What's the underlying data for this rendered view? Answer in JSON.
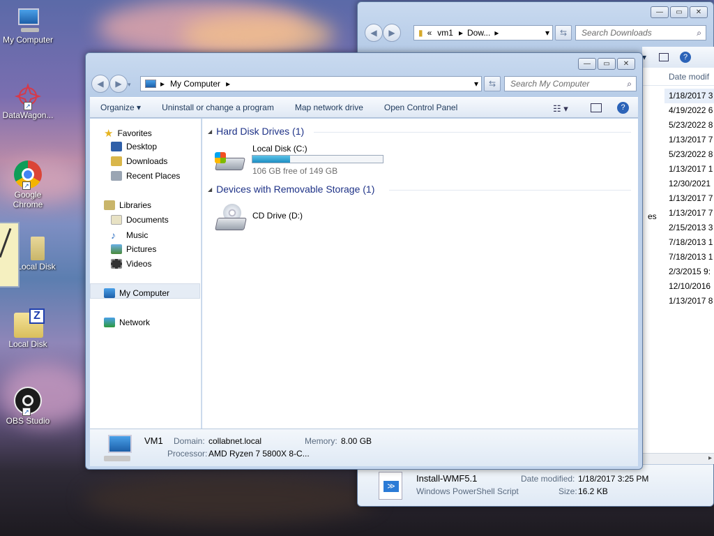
{
  "desktop_icons": [
    {
      "label": "My Computer"
    },
    {
      "label": "DataWagon..."
    },
    {
      "label": "Google Chrome"
    },
    {
      "label": "Local Disk"
    },
    {
      "label": "Local Disk"
    },
    {
      "label": "OBS Studio"
    }
  ],
  "back_window": {
    "breadcrumb": [
      "«",
      "vm1",
      "Dow..."
    ],
    "search_placeholder": "Search Downloads",
    "column_header": "Date modif",
    "dates": [
      "1/18/2017 3",
      "4/19/2022 6",
      "5/23/2022 8",
      "1/13/2017 7",
      "5/23/2022 8",
      "1/13/2017 1",
      "12/30/2021",
      "1/13/2017 7",
      "1/13/2017 7",
      "2/15/2013 3",
      "7/18/2013 1",
      "7/18/2013 1",
      "2/3/2015 9:",
      "12/10/2016",
      "1/13/2017 8"
    ],
    "partial_text": "es",
    "details": {
      "file_name": "Install-WMF5.1",
      "file_type": "Windows PowerShell Script",
      "date_label": "Date modified:",
      "date_value": "1/18/2017 3:25 PM",
      "size_label": "Size:",
      "size_value": "16.2 KB"
    }
  },
  "window": {
    "address": "My Computer",
    "search_placeholder": "Search My Computer",
    "toolbar": {
      "organize": "Organize",
      "uninstall": "Uninstall or change a program",
      "map_drive": "Map network drive",
      "control_panel": "Open Control Panel"
    },
    "nav": {
      "favorites": "Favorites",
      "desktop": "Desktop",
      "downloads": "Downloads",
      "recent": "Recent Places",
      "libraries": "Libraries",
      "documents": "Documents",
      "music": "Music",
      "pictures": "Pictures",
      "videos": "Videos",
      "my_computer": "My Computer",
      "network": "Network"
    },
    "groups": {
      "hdd": "Hard Disk Drives (1)",
      "removable": "Devices with Removable Storage (1)"
    },
    "drive_c": {
      "name": "Local Disk (C:)",
      "free": "106 GB free of 149 GB",
      "used_fraction": 0.29
    },
    "drive_d": {
      "name": "CD Drive (D:)"
    },
    "details": {
      "name": "VM1",
      "domain_label": "Domain:",
      "domain_value": "collabnet.local",
      "memory_label": "Memory:",
      "memory_value": "8.00 GB",
      "processor_label": "Processor:",
      "processor_value": "AMD Ryzen 7 5800X 8-C..."
    }
  },
  "colors": {
    "accent": "#1e3287",
    "progress": "#2aa7d6"
  }
}
